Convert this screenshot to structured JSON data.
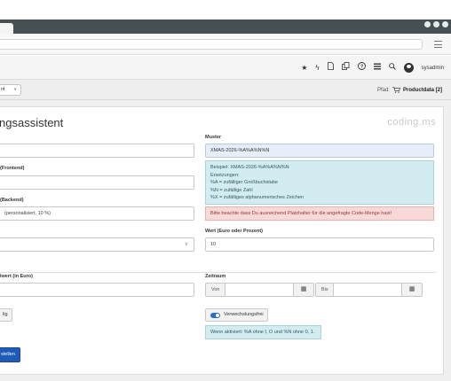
{
  "window": {
    "menu_label": "≡"
  },
  "toolbar": {
    "icons": [
      "star-icon",
      "bolt-icon",
      "file-icon",
      "copy-icon",
      "help-icon",
      "list-icon",
      "search-icon",
      "user-icon"
    ],
    "username": "sysadmin"
  },
  "docheader": {
    "language_select": "nt",
    "path_label": "Pfad:",
    "path_value": "Productdata [2]"
  },
  "form": {
    "title": "ngsassistent",
    "logo": "coding.ms",
    "left": {
      "field1_value": "",
      "field2_label": "(Frontend)",
      "field2_value": "",
      "field3_label": "(Backend)",
      "field3_value": "(personalisiert, 10 %)",
      "field4_value": "",
      "field5_label": "lwert (in Euro)",
      "field5_value": "",
      "toggle_label": "lig",
      "submit_label": "stellen"
    },
    "right": {
      "muster_label": "Muster",
      "muster_value": "XMAS-2026-%A%A%N%N",
      "info_lines": [
        "Beispiel: XMAS-2026-%A%A%N%N",
        "Ersetzungen:",
        "%A = zufälliger Großbuchstabe",
        "%N = zufällige Zahl",
        "%X = zufälliges alphanumerisches Zeichen"
      ],
      "warning": "Bitte beachte dass Du ausreichend Platzhalter für die angefragte Code-Menge hast!",
      "wert_label": "Wert (Euro oder Prozent)",
      "wert_value": "10",
      "zeitraum_label": "Zeitraum",
      "von_label": "Von",
      "bis_label": "Bis",
      "toggle_label": "Verwechslungsfrei",
      "toggle_info": "Wenn aktiviert: %A ohne I, O und %N ohne 0, 1."
    }
  },
  "colors": {
    "primary": "#1e5ab6",
    "info_bg": "#d3ecf2",
    "warning_bg": "#f8d9d8",
    "header_bar": "#445052"
  }
}
